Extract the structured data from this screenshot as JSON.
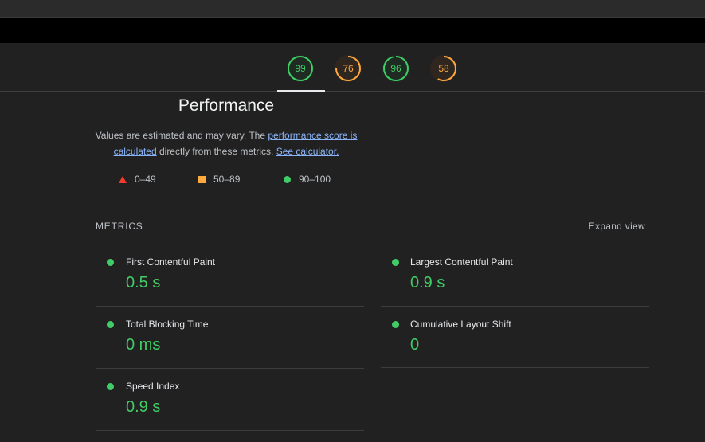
{
  "gauges": [
    {
      "score": "99",
      "fraction": 0.99,
      "color": "#40cc66",
      "track": "#1f2b22"
    },
    {
      "score": "76",
      "fraction": 0.76,
      "color": "#ffa93f",
      "track": "#2f2620"
    },
    {
      "score": "96",
      "fraction": 0.96,
      "color": "#40cc66",
      "track": "#1f2b22"
    },
    {
      "score": "58",
      "fraction": 0.58,
      "color": "#ffa93f",
      "track": "#2f2620"
    }
  ],
  "category": {
    "title": "Performance",
    "desc_part1": "Values are estimated and may vary. The ",
    "desc_link1": "performance score is calculated",
    "desc_part2": " directly from these metrics. ",
    "desc_link2": "See calculator."
  },
  "legend": {
    "fail": "0–49",
    "average": "50–89",
    "pass": "90–100"
  },
  "metrics_header": "METRICS",
  "expand_view": "Expand view",
  "metrics": {
    "fcp": {
      "name": "First Contentful Paint",
      "value": "0.5 s"
    },
    "lcp": {
      "name": "Largest Contentful Paint",
      "value": "0.9 s"
    },
    "tbt": {
      "name": "Total Blocking Time",
      "value": "0 ms"
    },
    "cls": {
      "name": "Cumulative Layout Shift",
      "value": "0"
    },
    "si": {
      "name": "Speed Index",
      "value": "0.9 s"
    }
  },
  "colors": {
    "pass": "#40cc66",
    "average": "#ffa93f",
    "fail": "#f23c30",
    "link": "#8ab4f8"
  }
}
